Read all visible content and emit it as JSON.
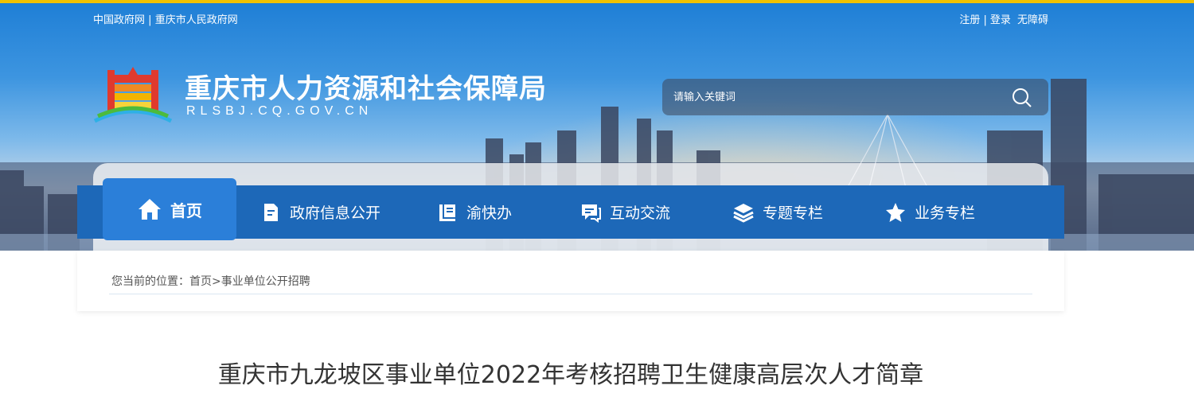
{
  "top_bar": {
    "left_links": [
      "中国政府网",
      "重庆市人民政府网"
    ],
    "left_separator": "|",
    "right_links": [
      "注册",
      "登录",
      "无障碍"
    ],
    "right_separator": "|",
    "accent_color": "#f2c200"
  },
  "header": {
    "site_title": "重庆市人力资源和社会保障局",
    "site_domain": "RLSBJ.CQ.GOV.CN",
    "logo_icon": "emblem-logo-icon"
  },
  "search": {
    "placeholder": "请输入关键词",
    "icon": "search-icon"
  },
  "nav": {
    "bar_color": "#1d68b8",
    "active_color": "#2b7fd9",
    "items": [
      {
        "label": "首页",
        "icon": "home-icon",
        "active": true
      },
      {
        "label": "政府信息公开",
        "icon": "document-icon",
        "active": false
      },
      {
        "label": "渝快办",
        "icon": "book-icon",
        "active": false
      },
      {
        "label": "互动交流",
        "icon": "chat-icon",
        "active": false
      },
      {
        "label": "专题专栏",
        "icon": "layers-icon",
        "active": false
      },
      {
        "label": "业务专栏",
        "icon": "star-icon",
        "active": false
      }
    ]
  },
  "breadcrumb": {
    "prefix": "您当前的位置：",
    "path": [
      "首页",
      "事业单位公开招聘"
    ],
    "separator": ">"
  },
  "article": {
    "title": "重庆市九龙坡区事业单位2022年考核招聘卫生健康高层次人才简章"
  }
}
